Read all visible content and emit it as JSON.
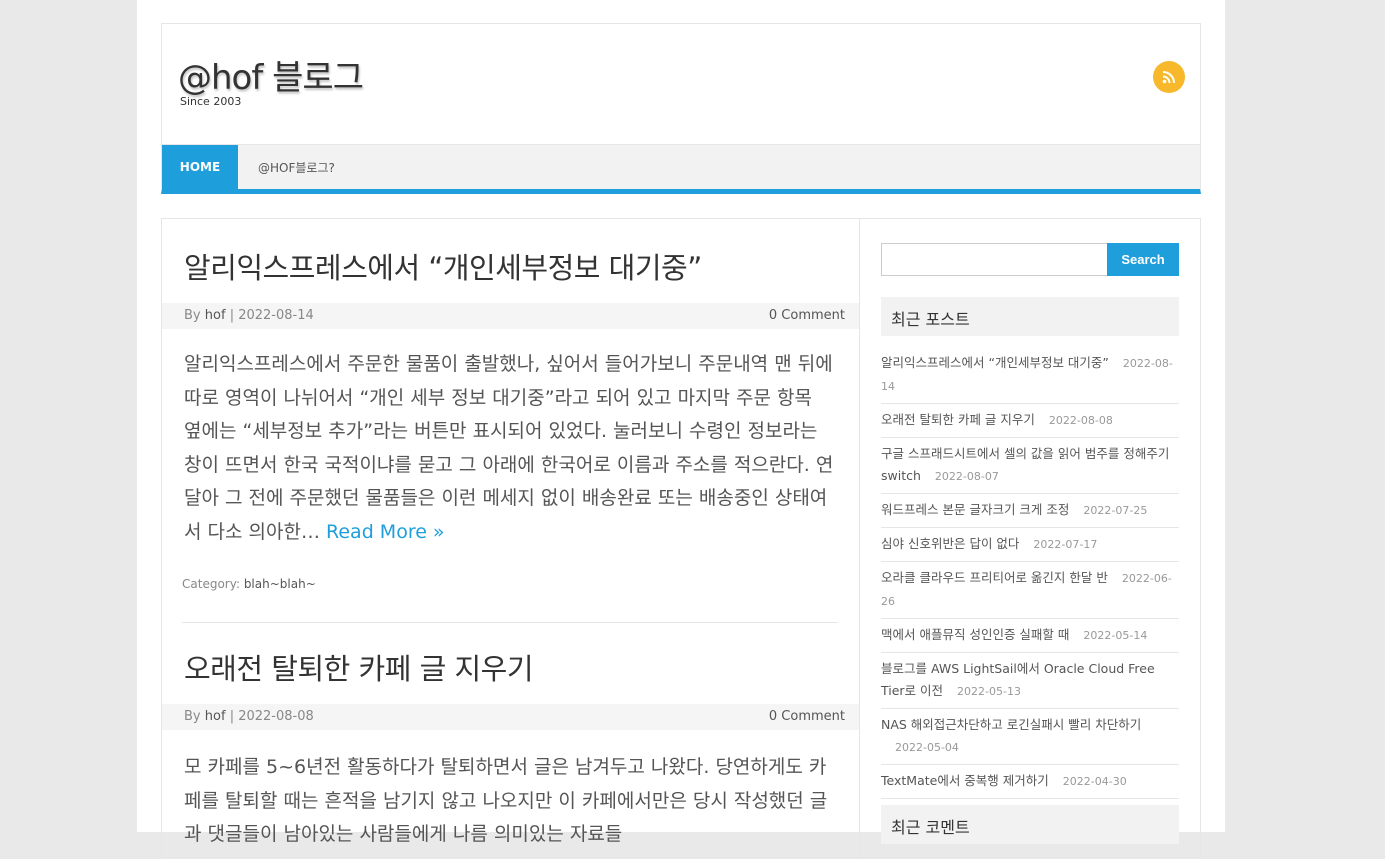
{
  "site": {
    "title": "@hof 블로그",
    "description": "Since 2003"
  },
  "icons": {
    "rss": "rss-icon"
  },
  "colors": {
    "accent": "#1e9fdc",
    "rss": "#f7b92b"
  },
  "nav": {
    "items": [
      {
        "label": "HOME"
      },
      {
        "label": "@HOF블로그?"
      }
    ]
  },
  "posts": [
    {
      "title": "알리익스프레스에서 “개인세부정보 대기중”",
      "by_label": "By",
      "author": "hof",
      "date": "2022-08-14",
      "comments": "0 Comment",
      "excerpt": "알리익스프레스에서 주문한 물품이 출발했나, 싶어서 들어가보니 주문내역 맨 뒤에 따로 영역이 나뉘어서 “개인 세부 정보 대기중”라고 되어 있고 마지막 주문 항목 옆에는 “세부정보 추가”라는 버튼만 표시되어 있었다. 눌러보니 수령인 정보라는 창이 뜨면서 한국 국적이냐를 묻고 그 아래에 한국어로 이름과 주소를 적으란다. 연달아 그 전에 주문했던 물품들은 이런 메세지 없이 배송완료 또는 배송중인 상태여서 다소 의아한…",
      "read_more": "Read More »",
      "category_label": "Category:",
      "category": "blah~blah~"
    },
    {
      "title": "오래전 탈퇴한 카페 글 지우기",
      "by_label": "By",
      "author": "hof",
      "date": "2022-08-08",
      "comments": "0 Comment",
      "excerpt": "모 카페를 5~6년전 활동하다가 탈퇴하면서 글은 남겨두고 나왔다. 당연하게도 카페를 탈퇴할 때는 흔적을 남기지 않고 나오지만 이 카페에서만은 당시 작성했던 글과 댓글들이 남아있는 사람들에게 나름 의미있는 자료들"
    }
  ],
  "sidebar": {
    "search_button": "Search",
    "search_placeholder": "",
    "recent_posts_title": "최근 포스트",
    "recent_comments_title": "최근 코멘트",
    "recent_posts": [
      {
        "title": "알리익스프레스에서 “개인세부정보 대기중”",
        "date": "2022-08-14"
      },
      {
        "title": "오래전 탈퇴한 카페 글 지우기",
        "date": "2022-08-08"
      },
      {
        "title": "구글 스프래드시트에서 셀의 값을 읽어 범주를 정해주기 switch",
        "date": "2022-08-07"
      },
      {
        "title": "워드프레스 본문 글자크기 크게 조정",
        "date": "2022-07-25"
      },
      {
        "title": "심야 신호위반은 답이 없다",
        "date": "2022-07-17"
      },
      {
        "title": "오라클 클라우드 프리티어로 옮긴지 한달 반",
        "date": "2022-06-26"
      },
      {
        "title": "맥에서 애플뮤직 성인인증 실패할 때",
        "date": "2022-05-14"
      },
      {
        "title": "블로그를 AWS LightSail에서 Oracle Cloud Free Tier로 이전",
        "date": "2022-05-13"
      },
      {
        "title": "NAS 해외접근차단하고 로긴실패시 빨리 차단하기",
        "date": "2022-05-04"
      },
      {
        "title": "TextMate에서 중복행 제거하기",
        "date": "2022-04-30"
      }
    ]
  }
}
